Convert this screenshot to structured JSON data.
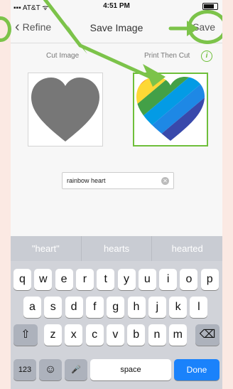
{
  "status": {
    "carrier": "AT&T",
    "time": "4:51 PM"
  },
  "nav": {
    "back_label": "Refine",
    "title": "Save Image",
    "save_label": "Save"
  },
  "options": {
    "cut_label": "Cut Image",
    "print_label": "Print Then Cut"
  },
  "name_field": {
    "value": "rainbow heart"
  },
  "suggestions": [
    "\"heart\"",
    "hearts",
    "hearted"
  ],
  "keyboard": {
    "row1": [
      "q",
      "w",
      "e",
      "r",
      "t",
      "y",
      "u",
      "i",
      "o",
      "p"
    ],
    "row2": [
      "a",
      "s",
      "d",
      "f",
      "g",
      "h",
      "j",
      "k",
      "l"
    ],
    "row3": [
      "z",
      "x",
      "c",
      "v",
      "b",
      "n",
      "m"
    ],
    "num_label": "123",
    "space_label": "space",
    "done_label": "Done"
  },
  "colors": {
    "accent": "#7cc34a",
    "done_key": "#1a82fb",
    "heart_gray": "#777777"
  }
}
